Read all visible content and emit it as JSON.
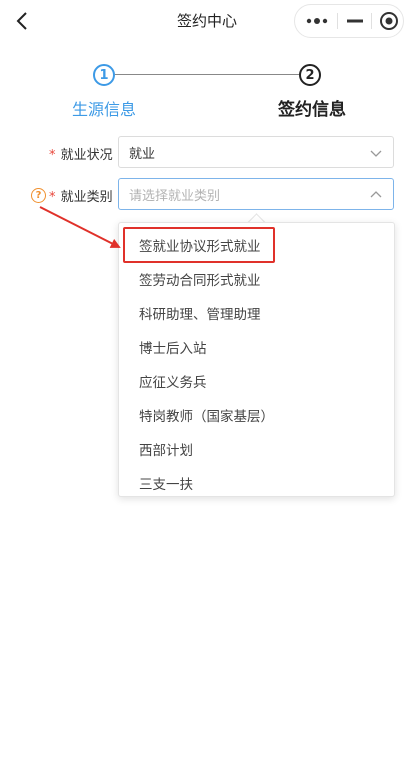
{
  "header": {
    "title": "签约中心"
  },
  "steps": [
    {
      "number": "1",
      "label": "生源信息",
      "state": "done"
    },
    {
      "number": "2",
      "label": "签约信息",
      "state": "current"
    }
  ],
  "form": {
    "employment_status": {
      "required_mark": "*",
      "label": "就业状况",
      "value": "就业"
    },
    "employment_category": {
      "required_mark": "*",
      "label": "就业类别",
      "placeholder": "请选择就业类别",
      "help_icon_text": "?"
    }
  },
  "dropdown": {
    "options": [
      "签就业协议形式就业",
      "签劳动合同形式就业",
      "科研助理、管理助理",
      "博士后入站",
      "应征义务兵",
      "特岗教师（国家基层）",
      "西部计划",
      "三支一扶"
    ],
    "highlighted_option_index": 0
  },
  "colors": {
    "accent": "#3d9ae6",
    "required": "#e8463a",
    "help": "#f0902f",
    "annotation": "#e0312a"
  },
  "icons": {
    "back": "chevron-left-icon",
    "more": "more-dots-icon",
    "minimize": "minimize-icon",
    "close": "target-close-icon",
    "dropdown_closed": "chevron-down-icon",
    "dropdown_open": "chevron-up-icon",
    "help": "help-circle-icon"
  }
}
